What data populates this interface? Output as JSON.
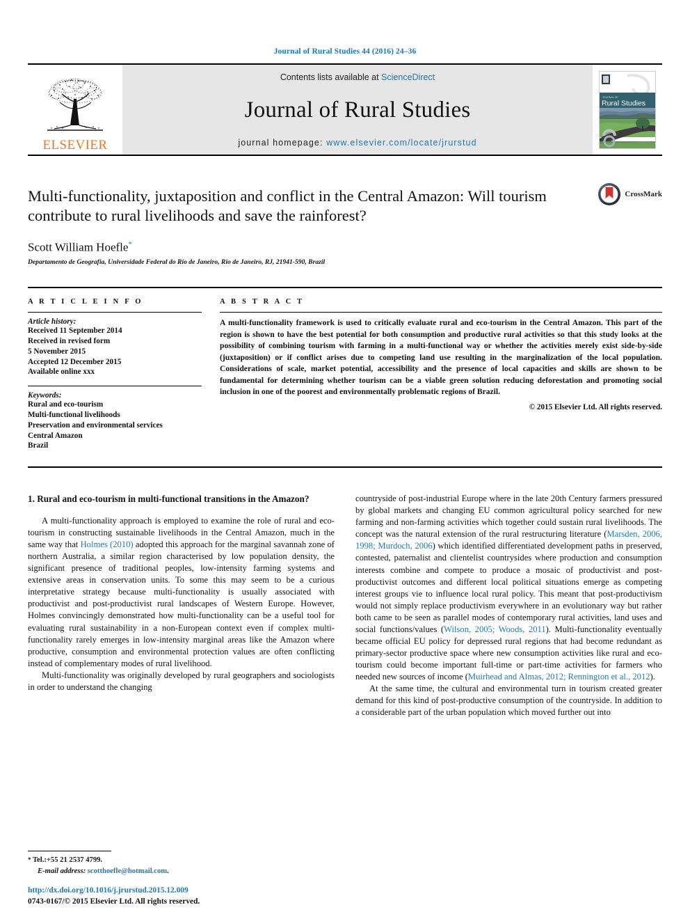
{
  "running_head": "Journal of Rural Studies 44 (2016) 24–36",
  "masthead": {
    "publisher_name": "ELSEVIER",
    "contents_prefix": "Contents lists available at ",
    "contents_link": "ScienceDirect",
    "journal_title": "Journal of Rural Studies",
    "homepage_prefix": "journal homepage: ",
    "homepage_url": "www.elsevier.com/locate/jrurstud",
    "cover_title": "Rural Studies",
    "cover_kicker": "JOURNAL OF"
  },
  "article": {
    "title": "Multi-functionality, juxtaposition and conflict in the Central Amazon: Will tourism contribute to rural livelihoods and save the rainforest?",
    "author": "Scott William Hoefle",
    "author_marker": "*",
    "affiliation": "Departamento de Geografia, Universidade Federal do Rio de Janeiro, Rio de Janeiro, RJ, 21941-590, Brazil",
    "crossmark_label": "CrossMark"
  },
  "article_info": {
    "heading": "A R T I C L E   I N F O",
    "history_label": "Article history:",
    "history": [
      "Received 11 September 2014",
      "Received in revised form",
      "5 November 2015",
      "Accepted 12 December 2015",
      "Available online xxx"
    ],
    "keywords_label": "Keywords:",
    "keywords": [
      "Rural and eco-tourism",
      "Multi-functional livelihoods",
      "Preservation and environmental services",
      "Central Amazon",
      "Brazil"
    ]
  },
  "abstract": {
    "heading": "A B S T R A C T",
    "text": "A multi-functionality framework is used to critically evaluate rural and eco-tourism in the Central Amazon. This part of the region is shown to have the best potential for both consumption and productive rural activities so that this study looks at the possibility of combining tourism with farming in a multi-functional way or whether the activities merely exist side-by-side (juxtaposition) or if conflict arises due to competing land use resulting in the marginalization of the local population. Considerations of scale, market potential, accessibility and the presence of local capacities and skills are shown to be fundamental for determining whether tourism can be a viable green solution reducing deforestation and promoting social inclusion in one of the poorest and environmentally problematic regions of Brazil.",
    "copyright": "© 2015 Elsevier Ltd. All rights reserved."
  },
  "body": {
    "section_heading": "1. Rural and eco-tourism in multi-functional transitions in the Amazon?",
    "left_paragraph_1_a": "A multi-functionality approach is employed to examine the role of rural and eco-tourism in constructing sustainable livelihoods in the Central Amazon, much in the same way that ",
    "left_cite_1": "Holmes (2010)",
    "left_paragraph_1_b": " adopted this approach for the marginal savannah zone of northern Australia, a similar region characterised by low population density, the significant presence of traditional peoples, low-intensity farming systems and extensive areas in conservation units. To some this may seem to be a curious interpretative strategy because multi-functionality is usually associated with productivist and post-productivist rural landscapes of Western Europe. However, Holmes convincingly demonstrated how multi-functionality can be a useful tool for evaluating rural sustainability in a non-European context even if complex multi-functionality rarely emerges in low-intensity marginal areas like the Amazon where productive, consumption and environmental protection values are often conflicting instead of complementary modes of rural livelihood.",
    "left_paragraph_2": "Multi-functionality was originally developed by rural geographers and sociologists in order to understand the changing",
    "right_paragraph_1_a": "countryside of post-industrial Europe where in the late 20th Century farmers pressured by global markets and changing EU common agricultural policy searched for new farming and non-farming activities which together could sustain rural livelihoods. The concept was the natural extension of the rural restructuring literature (",
    "right_cite_1": "Marsden, 2006, 1998; Murdoch, 2006",
    "right_paragraph_1_b": ") which identified differentiated development paths in preserved, contested, paternalist and clientelist countrysides where production and consumption interests combine and compete to produce a mosaic of productivist and post-productivist outcomes and different local political situations emerge as competing interest groups vie to influence local rural policy. This meant that post-productivism would not simply replace productivism everywhere in an evolutionary way but rather both came to be seen as parallel modes of contemporary rural activities, land uses and social functions/values (",
    "right_cite_2": "Wilson, 2005; Woods, 2011",
    "right_paragraph_1_c": "). Multi-functionality eventually became official EU policy for depressed rural regions that had become redundant as primary-sector productive space where new consumption activities like rural and eco-tourism could become important full-time or part-time activities for farmers who needed new sources of income (",
    "right_cite_3": "Muirhead and Almas, 2012; Rennington et al., 2012",
    "right_paragraph_1_d": ").",
    "right_paragraph_2": "At the same time, the cultural and environmental turn in tourism created greater demand for this kind of post-productive consumption of the countryside. In addition to a considerable part of the urban population which moved further out into"
  },
  "footnotes": {
    "marker": "*",
    "tel": "Tel.:+55 21 2537 4799.",
    "email_label": "E-mail address:",
    "email": "scotthoefle@hotmail.com",
    "email_suffix": "."
  },
  "footer": {
    "doi_url": "http://dx.doi.org/10.1016/j.jrurstud.2015.12.009",
    "issn_line": "0743-0167/© 2015 Elsevier Ltd. All rights reserved."
  },
  "colors": {
    "link_blue": "#1b7ab5",
    "elsevier_orange": "#e87722",
    "banner_gray": "#e6e6e6"
  }
}
